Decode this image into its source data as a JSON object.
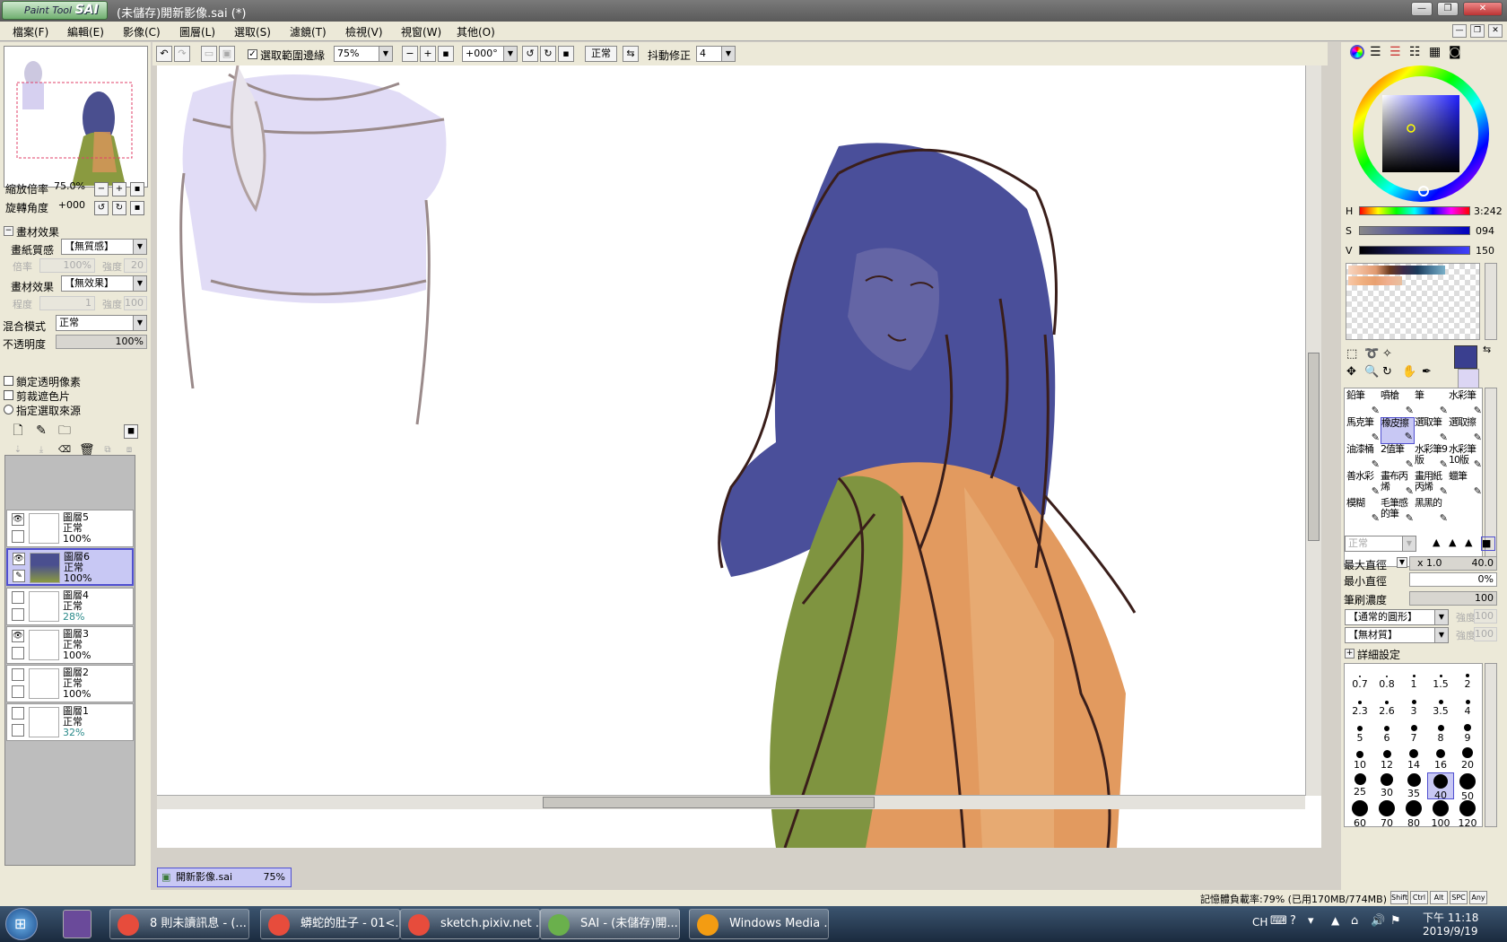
{
  "window": {
    "logo_text": "Paint Tool",
    "logo_bold": "SAI",
    "title": "(未儲存)開新影像.sai (*)"
  },
  "menu": [
    "檔案(F)",
    "編輯(E)",
    "影像(C)",
    "圖層(L)",
    "選取(S)",
    "濾鏡(T)",
    "檢視(V)",
    "視窗(W)",
    "其他(O)"
  ],
  "toolbar": {
    "antialias_label": "選取範圍邊緣",
    "zoom_value": "75%",
    "rotation_value": "+000°",
    "blend_value": "正常",
    "stabilizer_label": "抖動修正",
    "stabilizer_value": "4"
  },
  "left": {
    "zoom_label": "縮放倍率",
    "zoom_value": "75.0%",
    "rotate_label": "旋轉角度",
    "rotate_value": "+000",
    "texture_section": "畫材效果",
    "paper_label": "畫紙質感",
    "paper_value": "【無質感】",
    "paper_rate_label": "倍率",
    "paper_rate_value": "100%",
    "paper_strength_label": "強度",
    "paper_strength_value": "20",
    "effect_label": "畫材效果",
    "effect_value": "【無效果】",
    "effect_degree_label": "程度",
    "effect_degree_value": "1",
    "effect_strength_label": "強度",
    "effect_strength_value": "100",
    "blend_label": "混合模式",
    "blend_value": "正常",
    "opacity_label": "不透明度",
    "opacity_value": "100%",
    "lock_alpha": "鎖定透明像素",
    "clipping": "剪裁遮色片",
    "selection_source": "指定選取來源"
  },
  "layers": [
    {
      "name": "圖層5",
      "mode": "正常",
      "opacity": "100%",
      "visible": true,
      "selected": false
    },
    {
      "name": "圖層6",
      "mode": "正常",
      "opacity": "100%",
      "visible": true,
      "selected": true
    },
    {
      "name": "圖層4",
      "mode": "正常",
      "opacity": "28%",
      "visible": false,
      "selected": false
    },
    {
      "name": "圖層3",
      "mode": "正常",
      "opacity": "100%",
      "visible": true,
      "selected": false
    },
    {
      "name": "圖層2",
      "mode": "正常",
      "opacity": "100%",
      "visible": false,
      "selected": false
    },
    {
      "name": "圖層1",
      "mode": "正常",
      "opacity": "32%",
      "visible": false,
      "selected": false
    }
  ],
  "canvas_tab": {
    "name": "開新影像.sai",
    "zoom": "75%"
  },
  "color": {
    "h_label": "H",
    "h_value": "3:242",
    "s_label": "S",
    "s_value": "094",
    "v_label": "V",
    "v_value": "150",
    "primary": "#3a3f8f",
    "secondary": "#dcd6f4"
  },
  "brushes": [
    [
      "鉛筆",
      "噴槍",
      "筆",
      "水彩筆"
    ],
    [
      "馬克筆",
      "橡皮擦",
      "選取筆",
      "選取擦"
    ],
    [
      "油漆桶",
      "2值筆",
      "水彩筆9版",
      "水彩筆10版"
    ],
    [
      "善水彩",
      "畫布丙烯",
      "畫用紙丙烯",
      "蠟筆"
    ],
    [
      "模糊",
      "毛筆感的筆",
      "黑黑的",
      ""
    ]
  ],
  "brush_settings": {
    "mode_value": "正常",
    "max_size_label": "最大直徑",
    "max_size_mult": "x 1.0",
    "max_size_value": "40.0",
    "min_size_label": "最小直徑",
    "min_size_value": "0%",
    "density_label": "筆刷濃度",
    "density_value": "100",
    "shape_value": "【通常的圓形】",
    "shape_strength_label": "強度",
    "shape_strength_value": "100",
    "texture_value": "【無材質】",
    "texture_strength_label": "強度",
    "texture_strength_value": "100",
    "advanced_label": "詳細設定"
  },
  "sizes": [
    "0.7",
    "0.8",
    "1",
    "1.5",
    "2",
    "2.3",
    "2.6",
    "3",
    "3.5",
    "4",
    "5",
    "6",
    "7",
    "8",
    "9",
    "10",
    "12",
    "14",
    "16",
    "20",
    "25",
    "30",
    "35",
    "40",
    "50",
    "60",
    "70",
    "80",
    "100",
    "120"
  ],
  "status": {
    "memory": "記憶體負載率:79% (已用170MB/774MB)",
    "keys": [
      "Shift",
      "Ctrl",
      "Alt",
      "SPC",
      "Any"
    ]
  },
  "taskbar": {
    "items": [
      {
        "label": "8 則未讀訊息 - (...",
        "icon_color": "#e74c3c"
      },
      {
        "label": "蟒蛇的肚子 - 01<...",
        "icon_color": "#e74c3c"
      },
      {
        "label": "sketch.pixiv.net ...",
        "icon_color": "#e74c3c"
      },
      {
        "label": "SAI - (未儲存)開...",
        "icon_color": "#6ab04c"
      },
      {
        "label": "Windows Media ...",
        "icon_color": "#f39c12"
      }
    ],
    "lang": "CH",
    "time": "下午 11:18",
    "date": "2019/9/19"
  }
}
